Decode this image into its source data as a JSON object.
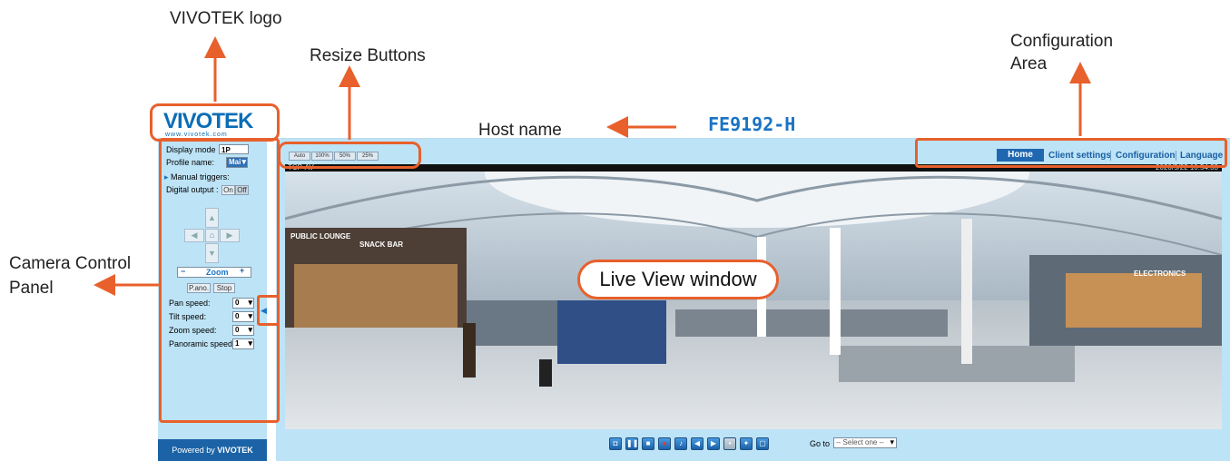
{
  "annotations": {
    "logo": "VIVOTEK logo",
    "resize": "Resize Buttons",
    "config_line1": "Configuration",
    "config_line2": "Area",
    "host": "Host name",
    "camera_line1": "Camera Control",
    "camera_line2": "Panel",
    "live_view": "Live View window"
  },
  "brand": {
    "logo_text": "VIVOTEK",
    "logo_sub": "www.vivotek.com",
    "footer_prefix": "Powered by",
    "footer_logo": "VIVOTEK"
  },
  "host_name": "FE9192-H",
  "left_panel": {
    "display_mode_label": "Display mode",
    "display_mode_value": "1P",
    "profile_label": "Profile name:",
    "profile_value": "Mai",
    "manual_triggers": "Manual triggers:",
    "digital_output_label": "Digital output :",
    "on_label": "On",
    "off_label": "Off",
    "zoom_label": "Zoom",
    "zoom_minus": "−",
    "zoom_plus": "+",
    "pano_button": "P.ano.",
    "stop_button": "Stop",
    "pan_speed_label": "Pan speed:",
    "pan_speed_value": "0",
    "tilt_speed_label": "Tilt speed:",
    "tilt_speed_value": "0",
    "zoom_speed_label": "Zoom speed:",
    "zoom_speed_value": "0",
    "panoramic_speed_label": "Panoramic speed:",
    "panoramic_speed_value": "1"
  },
  "resize_buttons": [
    "Auto",
    "100%",
    "50%",
    "25%"
  ],
  "nav": {
    "home": "Home",
    "client_settings": "Client settings",
    "configuration": "Configuration",
    "language": "Language"
  },
  "live_view": {
    "protocol": "TCP-AV",
    "timestamp": "2020/5/22 10:54:33",
    "signs": [
      "PUBLIC LOUNGE",
      "SNACK BAR",
      "ELECTRONICS"
    ]
  },
  "toolbar": {
    "icons": [
      "snapshot-icon",
      "pause-icon",
      "stop-icon",
      "record-icon",
      "volume-icon",
      "speaker-icon",
      "talk-icon",
      "mute-icon",
      "ptz-icon",
      "fullscreen-icon"
    ],
    "goto_label": "Go to",
    "goto_placeholder": "-- Select one --"
  },
  "colors": {
    "accent": "#e8602c",
    "panel_bg": "#bde3f6",
    "brand_blue": "#1a73c4",
    "nav_home_bg": "#1f67b1"
  }
}
